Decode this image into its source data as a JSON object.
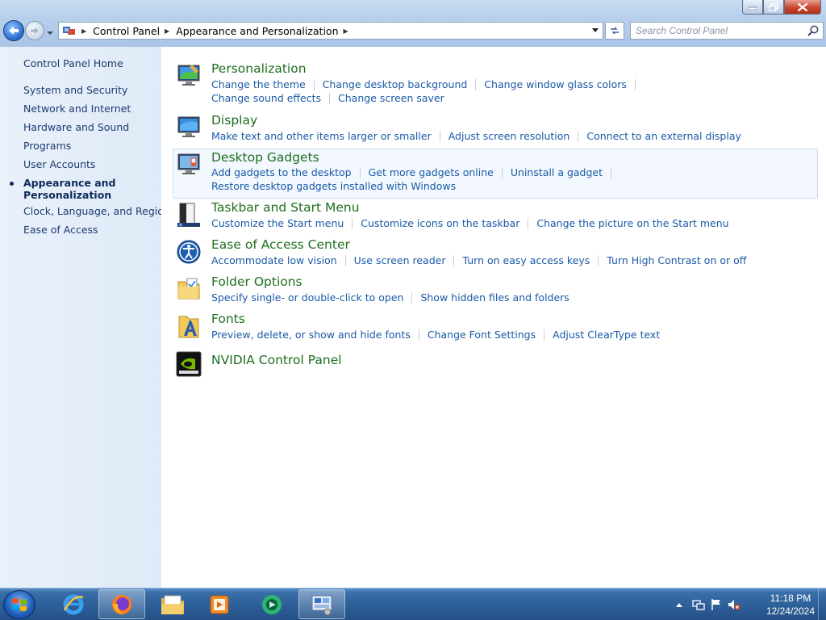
{
  "window": {
    "caption_buttons": [
      "minimize",
      "maximize",
      "close"
    ]
  },
  "address_bar": {
    "breadcrumbs": [
      "Control Panel",
      "Appearance and Personalization"
    ]
  },
  "search": {
    "placeholder": "Search Control Panel"
  },
  "left_pane": {
    "items": [
      {
        "label": "Control Panel Home",
        "current": false
      },
      {
        "label": "System and Security",
        "current": false
      },
      {
        "label": "Network and Internet",
        "current": false
      },
      {
        "label": "Hardware and Sound",
        "current": false
      },
      {
        "label": "Programs",
        "current": false
      },
      {
        "label": "User Accounts",
        "current": false
      },
      {
        "label": "Appearance and Personalization",
        "current": true
      },
      {
        "label": "Clock, Language, and Region",
        "current": false
      },
      {
        "label": "Ease of Access",
        "current": false
      }
    ]
  },
  "categories": [
    {
      "title": "Personalization",
      "icon": "personalization-icon",
      "tasks": [
        [
          "Change the theme",
          "Change desktop background",
          "Change window glass colors"
        ],
        [
          "Change sound effects",
          "Change screen saver"
        ]
      ]
    },
    {
      "title": "Display",
      "icon": "display-icon",
      "tasks": [
        [
          "Make text and other items larger or smaller",
          "Adjust screen resolution",
          "Connect to an external display"
        ]
      ]
    },
    {
      "title": "Desktop Gadgets",
      "icon": "desktop-gadgets-icon",
      "highlighted": true,
      "tasks": [
        [
          "Add gadgets to the desktop",
          "Get more gadgets online",
          "Uninstall a gadget"
        ],
        [
          "Restore desktop gadgets installed with Windows"
        ]
      ]
    },
    {
      "title": "Taskbar and Start Menu",
      "icon": "taskbar-icon",
      "tasks": [
        [
          "Customize the Start menu",
          "Customize icons on the taskbar",
          "Change the picture on the Start menu"
        ]
      ]
    },
    {
      "title": "Ease of Access Center",
      "icon": "ease-of-access-icon",
      "tasks": [
        [
          "Accommodate low vision",
          "Use screen reader",
          "Turn on easy access keys",
          "Turn High Contrast on or off"
        ]
      ]
    },
    {
      "title": "Folder Options",
      "icon": "folder-options-icon",
      "tasks": [
        [
          "Specify single- or double-click to open",
          "Show hidden files and folders"
        ]
      ]
    },
    {
      "title": "Fonts",
      "icon": "fonts-icon",
      "tasks": [
        [
          "Preview, delete, or show and hide fonts",
          "Change Font Settings",
          "Adjust ClearType text"
        ]
      ]
    },
    {
      "title": "NVIDIA Control Panel",
      "icon": "nvidia-icon",
      "tasks": []
    }
  ],
  "taskbar": {
    "pinned": [
      "start-orb",
      "internet-explorer-icon",
      "firefox-icon",
      "windows-explorer-icon",
      "media-player-icon",
      "media-center-icon",
      "control-panel-icon"
    ],
    "active_app": "control-panel-icon",
    "tray_icons": [
      "show-hidden-icons-arrow",
      "network-icon",
      "action-center-flag-icon",
      "volume-muted-icon"
    ],
    "clock_time": "11:18 PM",
    "clock_date": "12/24/2024"
  },
  "colors": {
    "link": "#1a5aa6",
    "category_title": "#1e6e1e",
    "nav_link": "#1e3a6e",
    "left_pane_bg": "#e3edf9",
    "taskbar": "#2d5f98"
  }
}
